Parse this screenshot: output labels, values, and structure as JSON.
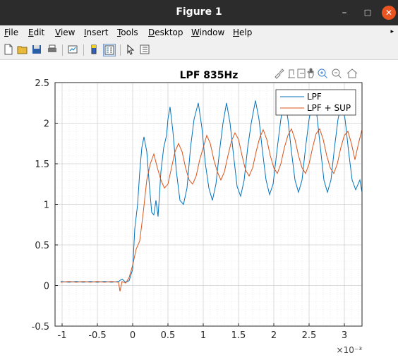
{
  "window": {
    "title": "Figure 1"
  },
  "menu": [
    "File",
    "Edit",
    "View",
    "Insert",
    "Tools",
    "Desktop",
    "Window",
    "Help"
  ],
  "menu_mnemonics": [
    "F",
    "E",
    "V",
    "I",
    "T",
    "D",
    "W",
    "H"
  ],
  "toolbar_icons": [
    "new-figure-icon",
    "open-file-icon",
    "save-icon",
    "print-icon",
    "link-plot-icon",
    "colorbar-icon",
    "legend-icon",
    "edit-plot-icon",
    "property-inspector-icon"
  ],
  "axes_toolbar_icons": [
    "brush-icon",
    "data-tips-icon",
    "export-icon",
    "pan-icon",
    "zoom-in-icon",
    "zoom-out-icon",
    "home-icon"
  ],
  "chart_data": {
    "type": "line",
    "title": "LPF 835Hz",
    "xlabel": "",
    "ylabel": "",
    "x_exponent_label": "×10⁻³",
    "xlim": [
      -1.1,
      3.25
    ],
    "ylim": [
      -0.5,
      2.5
    ],
    "xticks": [
      -1,
      -0.5,
      0,
      0.5,
      1,
      1.5,
      2,
      2.5,
      3
    ],
    "xtick_labels": [
      "-1",
      "-0.5",
      "0",
      "0.5",
      "1",
      "1.5",
      "2",
      "2.5",
      "3"
    ],
    "yticks": [
      -0.5,
      0,
      0.5,
      1,
      1.5,
      2,
      2.5
    ],
    "ytick_labels": [
      "-0.5",
      "0",
      "0.5",
      "1",
      "1.5",
      "2",
      "2.5"
    ],
    "grid": true,
    "minor_grid": true,
    "legend_position": "top-right",
    "series": [
      {
        "name": "LPF",
        "color": "#0072bd",
        "points": [
          [
            -1.02,
            0.05
          ],
          [
            -0.9,
            0.04
          ],
          [
            -0.8,
            0.05
          ],
          [
            -0.7,
            0.04
          ],
          [
            -0.6,
            0.05
          ],
          [
            -0.5,
            0.04
          ],
          [
            -0.4,
            0.05
          ],
          [
            -0.3,
            0.04
          ],
          [
            -0.2,
            0.05
          ],
          [
            -0.15,
            0.08
          ],
          [
            -0.1,
            0.04
          ],
          [
            -0.05,
            0.06
          ],
          [
            0,
            0.2
          ],
          [
            0.03,
            0.7
          ],
          [
            0.07,
            1.0
          ],
          [
            0.1,
            1.4
          ],
          [
            0.13,
            1.7
          ],
          [
            0.16,
            1.83
          ],
          [
            0.2,
            1.65
          ],
          [
            0.24,
            1.2
          ],
          [
            0.27,
            0.9
          ],
          [
            0.3,
            0.87
          ],
          [
            0.33,
            1.05
          ],
          [
            0.36,
            0.85
          ],
          [
            0.4,
            1.4
          ],
          [
            0.44,
            1.7
          ],
          [
            0.48,
            1.85
          ],
          [
            0.5,
            2.05
          ],
          [
            0.53,
            2.2
          ],
          [
            0.57,
            1.9
          ],
          [
            0.62,
            1.4
          ],
          [
            0.67,
            1.05
          ],
          [
            0.72,
            1.0
          ],
          [
            0.77,
            1.2
          ],
          [
            0.82,
            1.7
          ],
          [
            0.87,
            2.05
          ],
          [
            0.93,
            2.25
          ],
          [
            0.98,
            1.95
          ],
          [
            1.03,
            1.5
          ],
          [
            1.08,
            1.2
          ],
          [
            1.13,
            1.05
          ],
          [
            1.18,
            1.25
          ],
          [
            1.23,
            1.65
          ],
          [
            1.28,
            2.0
          ],
          [
            1.33,
            2.25
          ],
          [
            1.38,
            2.0
          ],
          [
            1.43,
            1.6
          ],
          [
            1.48,
            1.22
          ],
          [
            1.53,
            1.1
          ],
          [
            1.58,
            1.3
          ],
          [
            1.63,
            1.7
          ],
          [
            1.68,
            2.0
          ],
          [
            1.74,
            2.28
          ],
          [
            1.79,
            2.05
          ],
          [
            1.84,
            1.65
          ],
          [
            1.89,
            1.3
          ],
          [
            1.94,
            1.12
          ],
          [
            1.99,
            1.25
          ],
          [
            2.05,
            1.7
          ],
          [
            2.1,
            2.05
          ],
          [
            2.15,
            2.3
          ],
          [
            2.2,
            2.05
          ],
          [
            2.25,
            1.65
          ],
          [
            2.3,
            1.3
          ],
          [
            2.35,
            1.15
          ],
          [
            2.4,
            1.3
          ],
          [
            2.45,
            1.7
          ],
          [
            2.5,
            2.05
          ],
          [
            2.56,
            2.3
          ],
          [
            2.61,
            2.1
          ],
          [
            2.66,
            1.7
          ],
          [
            2.71,
            1.3
          ],
          [
            2.76,
            1.15
          ],
          [
            2.81,
            1.3
          ],
          [
            2.86,
            1.7
          ],
          [
            2.91,
            2.05
          ],
          [
            2.96,
            2.25
          ],
          [
            3.01,
            2.05
          ],
          [
            3.06,
            1.65
          ],
          [
            3.11,
            1.3
          ],
          [
            3.16,
            1.18
          ],
          [
            3.22,
            1.3
          ],
          [
            3.25,
            1.15
          ]
        ]
      },
      {
        "name": "LPF + SUP",
        "color": "#d95319",
        "points": [
          [
            -1.02,
            0.04
          ],
          [
            -0.9,
            0.05
          ],
          [
            -0.8,
            0.04
          ],
          [
            -0.7,
            0.05
          ],
          [
            -0.6,
            0.04
          ],
          [
            -0.5,
            0.05
          ],
          [
            -0.4,
            0.04
          ],
          [
            -0.3,
            0.05
          ],
          [
            -0.2,
            0.04
          ],
          [
            -0.18,
            -0.07
          ],
          [
            -0.15,
            0.05
          ],
          [
            -0.1,
            0.03
          ],
          [
            -0.05,
            0.1
          ],
          [
            0,
            0.25
          ],
          [
            0.05,
            0.45
          ],
          [
            0.1,
            0.55
          ],
          [
            0.15,
            0.9
          ],
          [
            0.2,
            1.3
          ],
          [
            0.25,
            1.5
          ],
          [
            0.3,
            1.62
          ],
          [
            0.35,
            1.45
          ],
          [
            0.4,
            1.3
          ],
          [
            0.45,
            1.2
          ],
          [
            0.5,
            1.25
          ],
          [
            0.55,
            1.45
          ],
          [
            0.6,
            1.65
          ],
          [
            0.65,
            1.75
          ],
          [
            0.7,
            1.65
          ],
          [
            0.75,
            1.45
          ],
          [
            0.8,
            1.3
          ],
          [
            0.85,
            1.25
          ],
          [
            0.9,
            1.35
          ],
          [
            0.95,
            1.55
          ],
          [
            1.0,
            1.7
          ],
          [
            1.05,
            1.85
          ],
          [
            1.1,
            1.75
          ],
          [
            1.15,
            1.55
          ],
          [
            1.2,
            1.4
          ],
          [
            1.25,
            1.3
          ],
          [
            1.3,
            1.4
          ],
          [
            1.35,
            1.6
          ],
          [
            1.4,
            1.78
          ],
          [
            1.45,
            1.88
          ],
          [
            1.5,
            1.8
          ],
          [
            1.55,
            1.6
          ],
          [
            1.6,
            1.42
          ],
          [
            1.65,
            1.35
          ],
          [
            1.7,
            1.45
          ],
          [
            1.75,
            1.65
          ],
          [
            1.8,
            1.82
          ],
          [
            1.85,
            1.92
          ],
          [
            1.9,
            1.8
          ],
          [
            1.95,
            1.6
          ],
          [
            2.0,
            1.45
          ],
          [
            2.05,
            1.38
          ],
          [
            2.1,
            1.5
          ],
          [
            2.15,
            1.7
          ],
          [
            2.2,
            1.85
          ],
          [
            2.25,
            1.93
          ],
          [
            2.3,
            1.8
          ],
          [
            2.35,
            1.6
          ],
          [
            2.4,
            1.45
          ],
          [
            2.45,
            1.38
          ],
          [
            2.5,
            1.5
          ],
          [
            2.55,
            1.7
          ],
          [
            2.6,
            1.87
          ],
          [
            2.65,
            1.93
          ],
          [
            2.7,
            1.8
          ],
          [
            2.75,
            1.6
          ],
          [
            2.8,
            1.45
          ],
          [
            2.85,
            1.38
          ],
          [
            2.9,
            1.5
          ],
          [
            2.95,
            1.7
          ],
          [
            3.0,
            1.85
          ],
          [
            3.05,
            1.9
          ],
          [
            3.1,
            1.75
          ],
          [
            3.15,
            1.55
          ],
          [
            3.2,
            1.75
          ],
          [
            3.25,
            1.92
          ]
        ]
      }
    ]
  }
}
